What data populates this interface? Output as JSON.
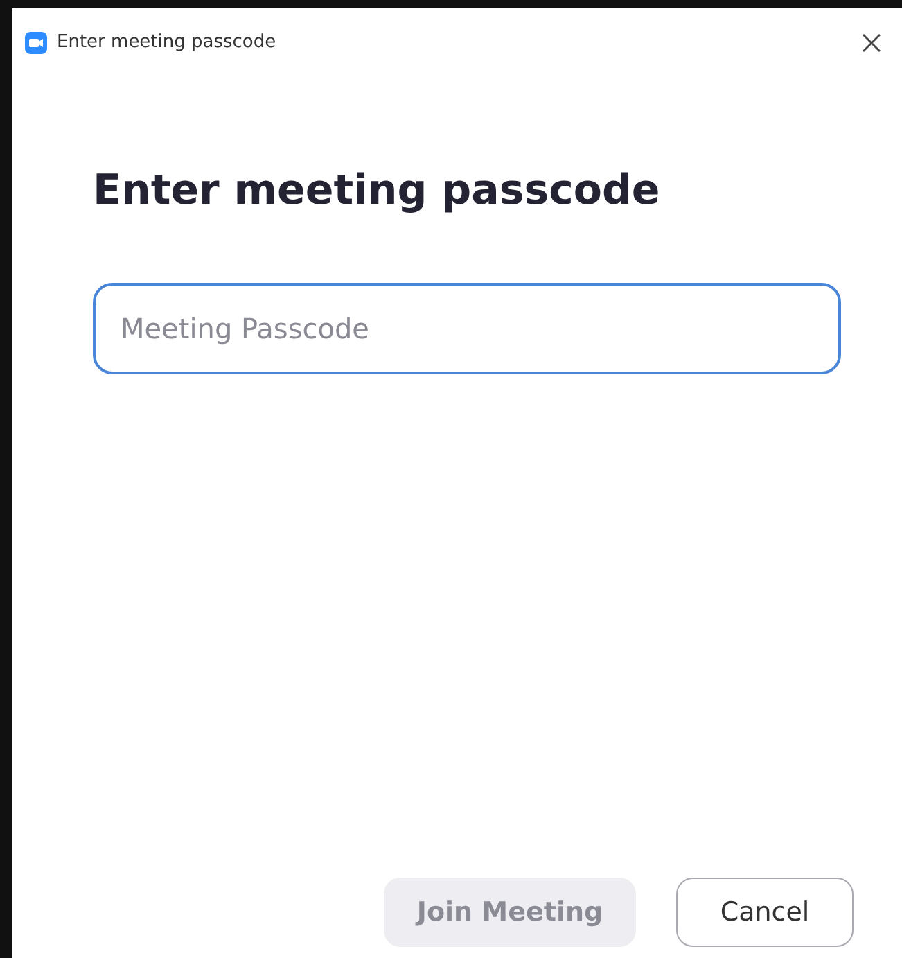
{
  "window": {
    "title": "Enter meeting passcode"
  },
  "heading": "Enter meeting passcode",
  "passcode": {
    "placeholder": "Meeting Passcode",
    "focused": true
  },
  "buttons": [
    {
      "label": "Join Meeting",
      "kind": "primary",
      "disabled": true
    },
    {
      "label": "Cancel",
      "kind": "secondary",
      "disabled": false
    }
  ]
}
